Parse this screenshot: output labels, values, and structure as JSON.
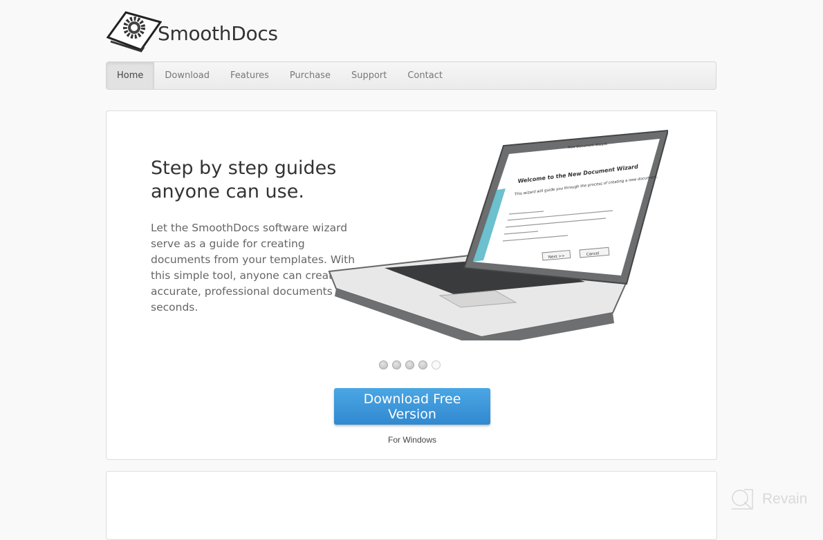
{
  "brand": {
    "name": "SmoothDocs"
  },
  "nav": {
    "items": [
      {
        "label": "Home",
        "active": true
      },
      {
        "label": "Download"
      },
      {
        "label": "Features"
      },
      {
        "label": "Purchase"
      },
      {
        "label": "Support"
      },
      {
        "label": "Contact"
      }
    ]
  },
  "hero": {
    "headline_line1": "Step by step guides",
    "headline_line2": "anyone can use.",
    "body": "Let the SmoothDocs software wizard serve as a guide for creating documents from your templates.  With this simple tool, anyone can create accurate, professional documents in seconds.",
    "screen": {
      "window_title": "New Document Wizard",
      "heading": "Welcome to the New Document Wizard",
      "intro": "This wizard will guide you through the process of creating a new document.",
      "next_label": "Next >>",
      "cancel_label": "Cancel"
    },
    "carousel": {
      "count": 5,
      "active_index": 4
    },
    "download_label": "Download Free Version",
    "platform_note": "For Windows"
  },
  "watermark": {
    "text": "Revain"
  },
  "colors": {
    "accent": "#3a96db",
    "background": "#f9f9f9"
  }
}
